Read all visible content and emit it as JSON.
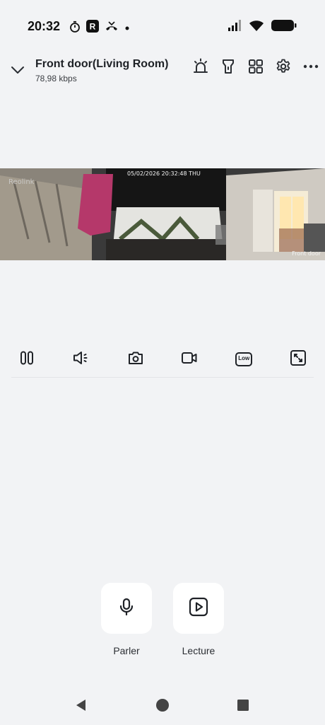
{
  "status_bar": {
    "time": "20:32",
    "left_icons": [
      "stopwatch-icon",
      "app-r-icon",
      "missed-call-icon",
      "dot-icon"
    ],
    "right_icons": [
      "signal-icon",
      "wifi-icon",
      "battery-icon"
    ]
  },
  "header": {
    "title": "Front door(Living Room)",
    "bitrate": "78,98 kbps",
    "actions": [
      "siren-icon",
      "floodlight-icon",
      "grid-icon",
      "settings-icon",
      "more-icon"
    ]
  },
  "video": {
    "brand_watermark": "Reolink",
    "timestamp": "05/02/2026 20:32:48 THU",
    "camera_label": "Front door"
  },
  "controls": {
    "items": [
      "pause-icon",
      "speaker-icon",
      "snapshot-icon",
      "record-icon",
      "quality-low-icon",
      "fullscreen-icon"
    ],
    "quality_label": "Low"
  },
  "actions": {
    "talk_label": "Parler",
    "playback_label": "Lecture"
  },
  "nav": {
    "items": [
      "back-icon",
      "home-icon",
      "recents-icon"
    ]
  }
}
